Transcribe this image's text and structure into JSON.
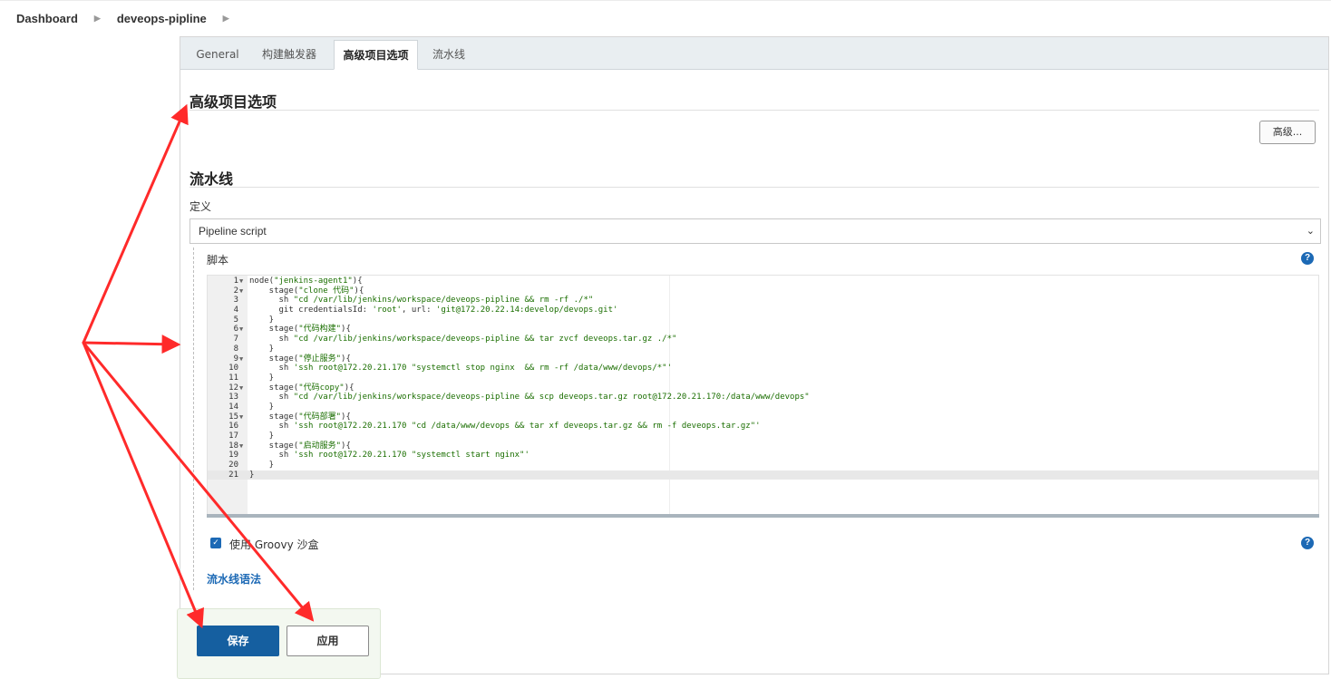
{
  "breadcrumb": {
    "items": [
      "Dashboard",
      "deveops-pipline"
    ]
  },
  "tabs": [
    {
      "label": "General"
    },
    {
      "label": "构建触发器"
    },
    {
      "label": "高级项目选项"
    },
    {
      "label": "流水线"
    }
  ],
  "active_tab": "高级项目选项",
  "advanced_section": {
    "title": "高级项目选项",
    "advanced_button_label": "高级..."
  },
  "pipeline_section": {
    "title": "流水线",
    "definition_label": "定义",
    "definition_value": "Pipeline script",
    "script_label": "脚本",
    "groovy_sandbox_label": "使用 Groovy 沙盒",
    "groovy_sandbox_checked": true,
    "syntax_link_label": "流水线语法"
  },
  "script": {
    "lines": [
      {
        "n": "1",
        "fold": true,
        "code": "node(\"jenkins-agent1\"){"
      },
      {
        "n": "2",
        "fold": true,
        "code": "    stage(\"clone 代码\"){"
      },
      {
        "n": "3",
        "fold": false,
        "code": "      sh \"cd /var/lib/jenkins/workspace/deveops-pipline && rm -rf ./*\""
      },
      {
        "n": "4",
        "fold": false,
        "code": "      git credentialsId: 'root', url: 'git@172.20.22.14:develop/devops.git'"
      },
      {
        "n": "5",
        "fold": false,
        "code": "    }"
      },
      {
        "n": "6",
        "fold": true,
        "code": "    stage(\"代码构建\"){"
      },
      {
        "n": "7",
        "fold": false,
        "code": "      sh \"cd /var/lib/jenkins/workspace/deveops-pipline && tar zvcf deveops.tar.gz ./*\""
      },
      {
        "n": "8",
        "fold": false,
        "code": "    }"
      },
      {
        "n": "9",
        "fold": true,
        "code": "    stage(\"停止服务\"){"
      },
      {
        "n": "10",
        "fold": false,
        "code": "      sh 'ssh root@172.20.21.170 \"systemctl stop nginx  && rm -rf /data/www/devops/*\"'"
      },
      {
        "n": "11",
        "fold": false,
        "code": "    }"
      },
      {
        "n": "12",
        "fold": true,
        "code": "    stage(\"代码copy\"){"
      },
      {
        "n": "13",
        "fold": false,
        "code": "      sh \"cd /var/lib/jenkins/workspace/deveops-pipline && scp deveops.tar.gz root@172.20.21.170:/data/www/devops\""
      },
      {
        "n": "14",
        "fold": false,
        "code": "    }"
      },
      {
        "n": "15",
        "fold": true,
        "code": "    stage(\"代码部署\"){"
      },
      {
        "n": "16",
        "fold": false,
        "code": "      sh 'ssh root@172.20.21.170 \"cd /data/www/devops && tar xf deveops.tar.gz && rm -f deveops.tar.gz\"'"
      },
      {
        "n": "17",
        "fold": false,
        "code": "    }"
      },
      {
        "n": "18",
        "fold": true,
        "code": "    stage(\"启动服务\"){"
      },
      {
        "n": "19",
        "fold": false,
        "code": "      sh 'ssh root@172.20.21.170 \"systemctl start nginx\"'"
      },
      {
        "n": "20",
        "fold": false,
        "code": "    }"
      },
      {
        "n": "21",
        "fold": false,
        "code": "}"
      }
    ],
    "active_line": "21"
  },
  "buttons": {
    "save_label": "保存",
    "apply_label": "应用"
  },
  "icons": {
    "help": "help-icon",
    "breadcrumb_separator": "chevron-right-icon",
    "select_caret": "chevron-down-icon",
    "checkbox": "checkmark-icon"
  },
  "colors": {
    "primary_button": "#155fa0",
    "link": "#1c69b5",
    "annotation_arrow": "#ff2a2a",
    "tab_bar": "#e9eef1",
    "code_string": "#1a6e00"
  }
}
